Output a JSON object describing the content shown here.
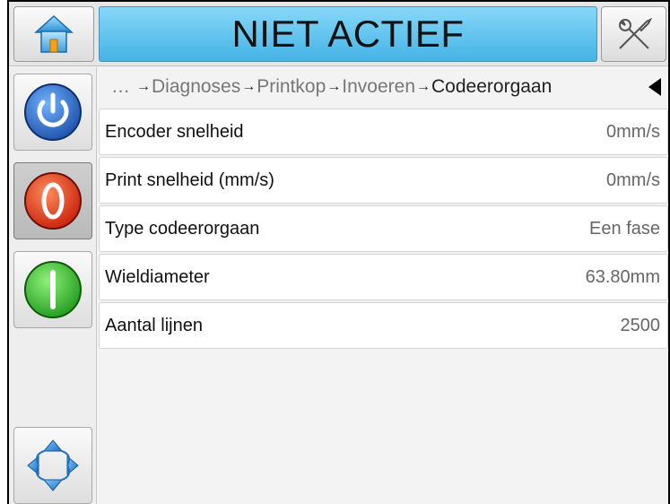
{
  "header": {
    "status": "NIET ACTIEF",
    "status_color": "#5cc3ef"
  },
  "breadcrumb": {
    "ellipsis": "…",
    "items": [
      "Diagnoses",
      "Printkop",
      "Invoeren",
      "Codeerorgaan"
    ],
    "separator": "→"
  },
  "rows": [
    {
      "label": "Encoder snelheid",
      "value": "0mm/s"
    },
    {
      "label": "Print snelheid (mm/s)",
      "value": "0mm/s"
    },
    {
      "label": "Type codeerorgaan",
      "value": "Een fase"
    },
    {
      "label": "Wieldiameter",
      "value": "63.80mm"
    },
    {
      "label": "Aantal lijnen",
      "value": "2500"
    }
  ],
  "icons": {
    "home": "home-icon",
    "tools": "tools-icon",
    "power": "power-icon",
    "stop": "stop-icon",
    "start": "start-icon",
    "navigate": "navigate-arrows-icon",
    "back": "back-arrow-icon"
  },
  "colors": {
    "power": "#2f6fc9",
    "stop": "#e03a1e",
    "start": "#38c73a"
  }
}
